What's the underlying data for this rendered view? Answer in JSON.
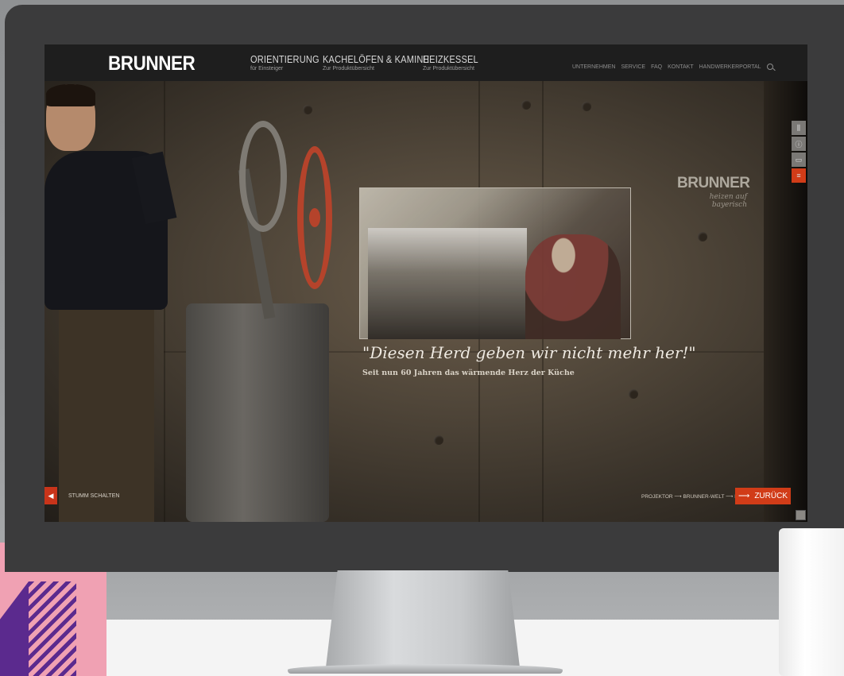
{
  "site": {
    "logo": "BRUNNER",
    "nav": [
      {
        "title": "ORIENTIERUNG",
        "subtitle": "für Einsteiger"
      },
      {
        "title": "KACHELÖFEN & KAMINE",
        "subtitle": "Zur Produktübersicht"
      },
      {
        "title": "HEIZKESSEL",
        "subtitle": "Zur Produktübersicht"
      }
    ],
    "utility_links": [
      "UNTERNEHMEN",
      "SERVICE",
      "FAQ",
      "KONTAKT",
      "HANDWERKERPORTAL"
    ],
    "utility_icon": "search-icon"
  },
  "hero": {
    "quote": "\"Diesen Herd geben wir nicht mehr her!\"",
    "subquote": "Seit nun 60 Jahren das wärmende Herz der Küche",
    "wall_brand": "BRUNNER",
    "wall_tagline": "heizen auf bayerisch"
  },
  "sidebar_icons": [
    "sliders-icon",
    "info-icon",
    "chat-icon",
    "document-icon"
  ],
  "controls": {
    "mute_label": "STUMM SCHALTEN",
    "breadcrumb": "PROJEKTOR ⟶ BRUNNER-WELT ⟶ HOME",
    "back_label": "ZURÜCK",
    "back_arrow": "⟶"
  },
  "colors": {
    "accent": "#d13c18",
    "nav_bg": "#1e1e1e",
    "deco_pink": "#f0a1b3",
    "deco_purple": "#5b2a8e"
  }
}
